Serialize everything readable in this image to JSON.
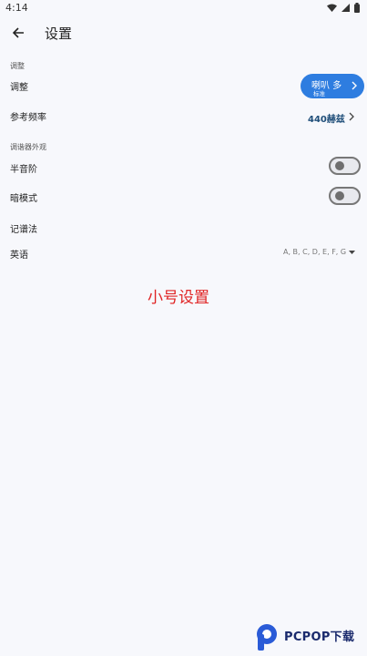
{
  "status_bar": {
    "time": "4:14"
  },
  "header": {
    "title": "设置"
  },
  "sections": [
    {
      "title": "调整"
    },
    {
      "title": "调谐器外观"
    }
  ],
  "tuning": {
    "label": "调整",
    "instrument": "喇叭 多",
    "mode": "标准",
    "reference_label": "参考频率",
    "reference_value": "440赫兹"
  },
  "appearance": {
    "semitone_label": "半音阶",
    "semitone_on": false,
    "dark_label": "暗模式",
    "dark_on": false,
    "notation_title": "记谱法",
    "notation_label": "英语",
    "notation_value": "A, B, C, D, E, F, G"
  },
  "caption": "小号设置",
  "watermark": {
    "text": "PCPOP下载"
  },
  "colors": {
    "accent": "#2e7de0",
    "caption": "#e02424",
    "background": "#f7f8fc"
  }
}
